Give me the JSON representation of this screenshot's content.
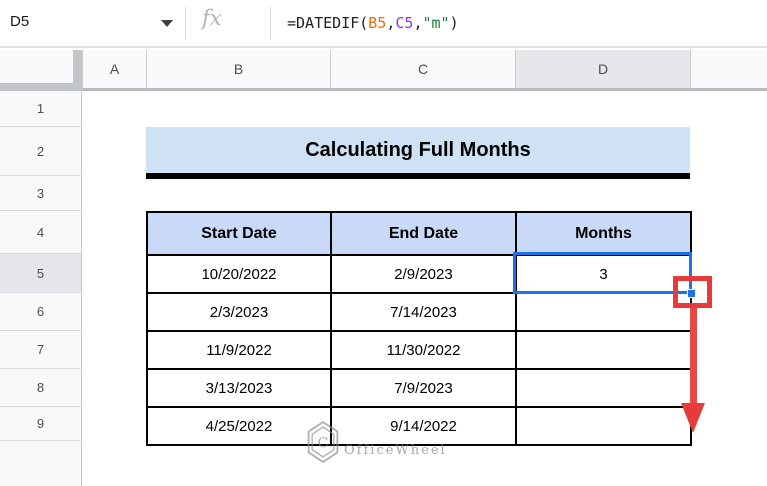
{
  "formula_bar": {
    "name_box_value": "D5",
    "fx_icon": "fx",
    "formula_parts": {
      "func": "=DATEDIF(",
      "arg1": "B5",
      "comma1": ",",
      "arg2": "C5",
      "comma2": ",",
      "arg3": "\"m\"",
      "close": ")"
    }
  },
  "grid": {
    "column_headers": [
      "A",
      "B",
      "C",
      "D"
    ],
    "row_headers": [
      "1",
      "2",
      "3",
      "4",
      "5",
      "6",
      "7",
      "8",
      "9"
    ],
    "selected_cell": "D5"
  },
  "sheet": {
    "title": "Calculating Full Months",
    "table": {
      "headers": [
        "Start Date",
        "End Date",
        "Months"
      ],
      "rows": [
        [
          "10/20/2022",
          "2/9/2023",
          "3"
        ],
        [
          "2/3/2023",
          "7/14/2023",
          ""
        ],
        [
          "11/9/2022",
          "11/30/2022",
          ""
        ],
        [
          "3/13/2023",
          "7/9/2023",
          ""
        ],
        [
          "4/25/2022",
          "9/14/2022",
          ""
        ]
      ]
    }
  },
  "watermark": {
    "text": "OfficeWheel"
  },
  "colors": {
    "selection_blue": "#1a73e8",
    "highlight_red": "#e73b3b",
    "banner_blue": "#cfe2f3",
    "table_header_blue": "#c9daf8",
    "header_gray": "#e5e7ea",
    "formula_arg1_orange": "#e8710a",
    "formula_arg2_purple": "#9334e6",
    "formula_arg3_green": "#188038"
  }
}
